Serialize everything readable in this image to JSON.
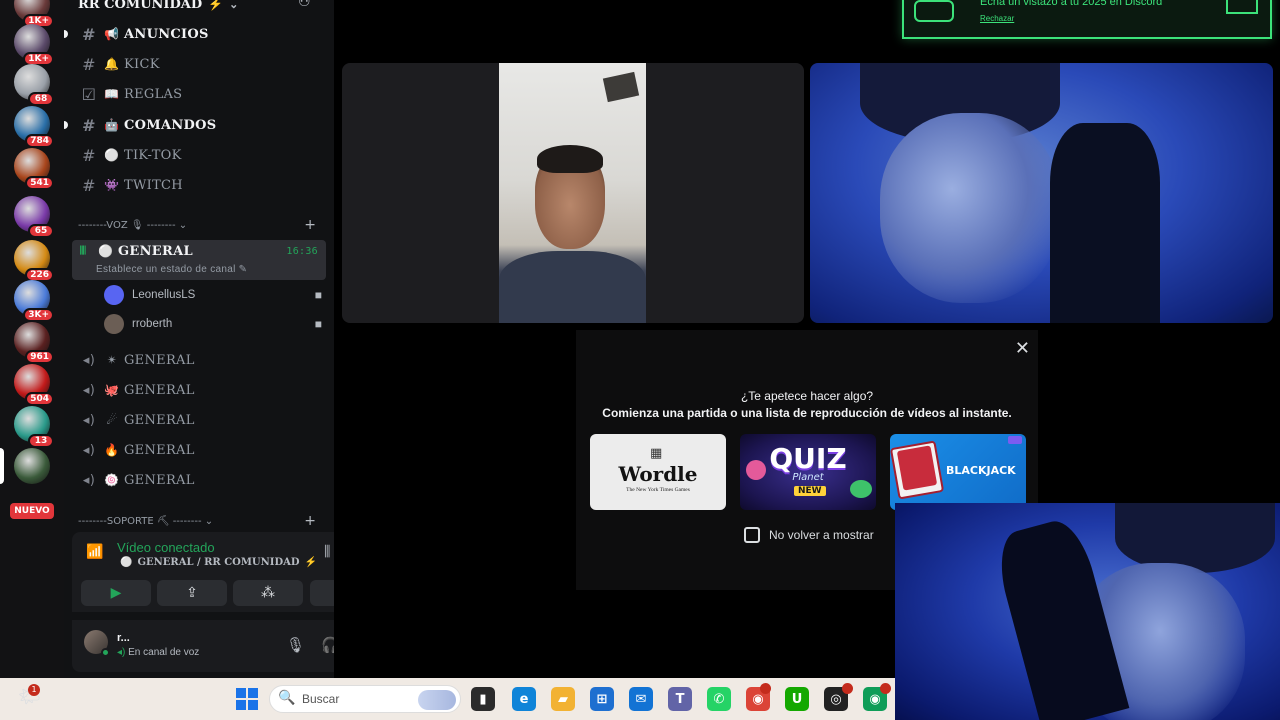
{
  "servers": [
    {
      "badge": "1K+",
      "color": "#6a3a3a"
    },
    {
      "badge": "1K+",
      "color": "#5b4a6a"
    },
    {
      "badge": "68",
      "color": "#9aa0a8"
    },
    {
      "badge": "784",
      "color": "#2a6fa8"
    },
    {
      "badge": "541",
      "color": "#a8451c"
    },
    {
      "badge": "65",
      "color": "#7a3aa8"
    },
    {
      "badge": "226",
      "color": "#d48a14"
    },
    {
      "badge": "3K+",
      "color": "#4a7ad8"
    },
    {
      "badge": "961",
      "color": "#5a2020"
    },
    {
      "badge": "504",
      "color": "#c21a1a"
    },
    {
      "badge": "13",
      "color": "#2a9a8a"
    },
    {
      "badge": "",
      "color": "#3a5a3a"
    }
  ],
  "nuevo_label": "NUEVO",
  "guild": {
    "name": "RR COMUNIDAD",
    "flame": "⚡",
    "chevron": "⌄",
    "add_user_icon": "⛄"
  },
  "text_channels": [
    {
      "name": "ANUNCIOS",
      "icon": "📢",
      "symbol": "#",
      "unread": true
    },
    {
      "name": "KICK",
      "icon": "🔔",
      "symbol": "#",
      "unread": false
    },
    {
      "name": "REGLAS",
      "icon": "📖",
      "symbol": "☑",
      "unread": false
    },
    {
      "name": "COMANDOS",
      "icon": "🤖",
      "symbol": "#",
      "unread": true
    },
    {
      "name": "TIK-TOK",
      "icon": "⚪",
      "symbol": "#",
      "unread": false
    },
    {
      "name": "TWITCH",
      "icon": "👾",
      "symbol": "#",
      "unread": false
    }
  ],
  "voice_category": "--------VOZ 🎙 -------- ⌄",
  "active_voice": {
    "name": "GENERAL",
    "time": "16:36",
    "status": "Establece un estado de canal ✎",
    "icon": "⚪",
    "symbol": "𝄃𝄃"
  },
  "members": [
    {
      "name": "LeonellusLS",
      "avatar_color": "#5865f2"
    },
    {
      "name": "rroberth",
      "avatar_color": "#6b5e55"
    }
  ],
  "other_voice": [
    {
      "name": "GENERAL",
      "icon": "✴"
    },
    {
      "name": "GENERAL",
      "icon": "🐙"
    },
    {
      "name": "GENERAL",
      "icon": "☄"
    },
    {
      "name": "GENERAL",
      "icon": "🔥"
    },
    {
      "name": "GENERAL",
      "icon": "🍥"
    }
  ],
  "support_category": "--------SOPORTE ⛏ -------- ⌄",
  "plus": "+",
  "voice_panel": {
    "title": "Vídeo conectado",
    "channel": "GENERAL / RR COMUNIDAD",
    "flame": "⚡",
    "buttons": [
      "▶",
      "⇪",
      "⁂",
      "✺"
    ]
  },
  "user": {
    "name": "r...",
    "status": "En canal de voz"
  },
  "overlay": {
    "question": "¿Te apetece hacer algo?",
    "subtitle": "Comienza una partida o una lista de reproducción de vídeos al instante.",
    "close": "✕",
    "activities": {
      "wordle": {
        "title": "Wordle",
        "grid": "▦",
        "publisher": "The New York Times Games"
      },
      "quiz": {
        "title": "QUIZ",
        "sub": "Planet",
        "badge": "NEW"
      },
      "blackjack": {
        "title": "BLACKJACK"
      }
    },
    "checkbox_label": "No volver a mostrar"
  },
  "toast": {
    "title": "Echa un vistazo a tu 2025 en Discord",
    "link": "Rechazar"
  },
  "taskbar": {
    "search_placeholder": "Buscar",
    "search_icon": "🔍",
    "weather_badge": "1",
    "apps": [
      {
        "name": "file-explorer-app",
        "glyph": "▮",
        "color": "#2b2b2b"
      },
      {
        "name": "edge-app",
        "glyph": "e",
        "color": "#0f84d8"
      },
      {
        "name": "folder-app",
        "glyph": "▰",
        "color": "#f2b233"
      },
      {
        "name": "store-app",
        "glyph": "⊞",
        "color": "#1e6fd0"
      },
      {
        "name": "outlook-app",
        "glyph": "✉",
        "color": "#1273d4"
      },
      {
        "name": "teams-app",
        "glyph": "T",
        "color": "#6264a7"
      },
      {
        "name": "whatsapp-app",
        "glyph": "✆",
        "color": "#25d366"
      },
      {
        "name": "chrome-app",
        "glyph": "◉",
        "color": "#db4437"
      },
      {
        "name": "upwork-app",
        "glyph": "U",
        "color": "#14a800"
      },
      {
        "name": "obs-app",
        "glyph": "◎",
        "color": "#222222"
      },
      {
        "name": "chrome-app-2",
        "glyph": "◉",
        "color": "#0f9d58"
      }
    ]
  }
}
